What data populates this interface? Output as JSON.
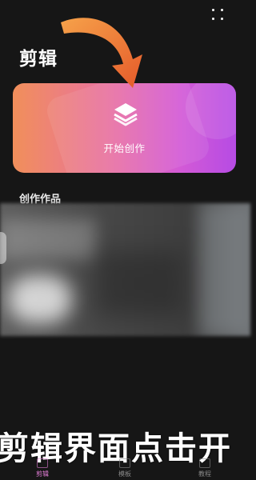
{
  "app_title": "剪辑",
  "start_card": {
    "label": "开始创作",
    "icon": "layers-icon"
  },
  "works_section": {
    "title": "创作作品"
  },
  "caption": "剪辑界面点击开",
  "bottom_nav": [
    {
      "label": "剪辑",
      "active": true
    },
    {
      "label": "模板",
      "active": false
    },
    {
      "label": "教程",
      "active": false
    }
  ],
  "colors": {
    "card_start": "#f18f5a",
    "card_end": "#b64be4",
    "arrow": "#f08035",
    "active_nav": "#e07cd4"
  }
}
